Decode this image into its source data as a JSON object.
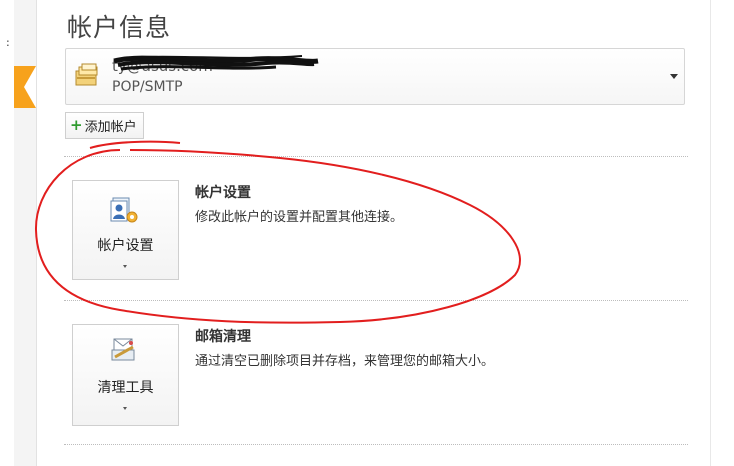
{
  "left_edge": {
    "colon": ":"
  },
  "page": {
    "title": "帐户信息"
  },
  "account": {
    "email_visible": "ty@asus.com",
    "type": "POP/SMTP"
  },
  "buttons": {
    "add_account": "添加帐户"
  },
  "sections": [
    {
      "button_label": "帐户设置",
      "title": "帐户设置",
      "description": "修改此帐户的设置并配置其他连接。",
      "icon": "account-settings-icon"
    },
    {
      "button_label": "清理工具",
      "title": "邮箱清理",
      "description": "通过清空已删除项目并存档，来管理您的邮箱大小。",
      "icon": "cleanup-tools-icon"
    }
  ],
  "colors": {
    "accent": "#f7a21c",
    "annotation": "#e21e1e",
    "plus": "#2f9b2f"
  }
}
